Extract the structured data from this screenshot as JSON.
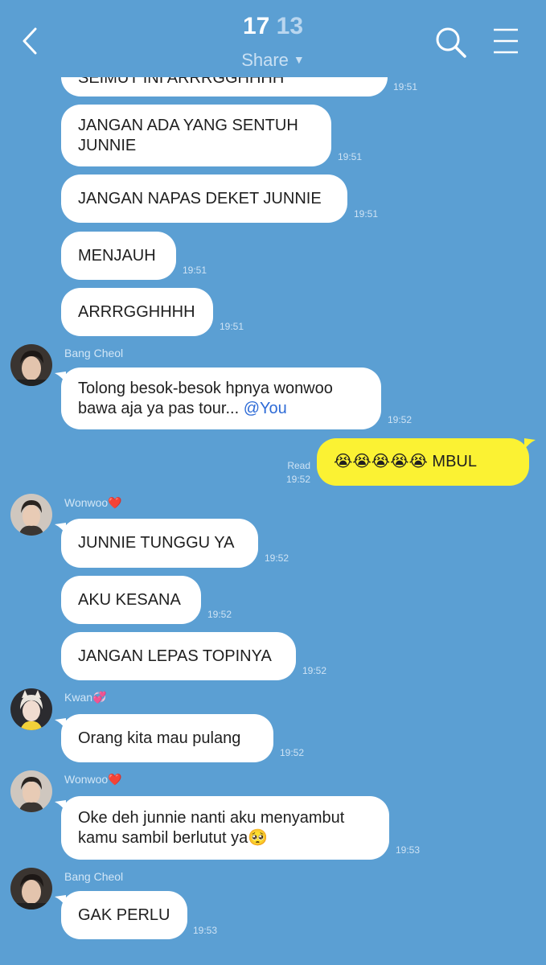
{
  "header": {
    "time_hour": "17",
    "time_min": "13",
    "share_label": "Share",
    "back_icon": "chevron-left-icon",
    "search_icon": "search-icon",
    "menu_icon": "hamburger-menu-icon"
  },
  "messages": [
    {
      "text": "SEIMUT INI ARRRGGHHHH",
      "time": "19:51"
    },
    {
      "text": "JANGAN ADA YANG SENTUH\nJUNNIE",
      "time": "19:51"
    },
    {
      "text": "JANGAN NAPAS DEKET JUNNIE",
      "time": "19:51"
    },
    {
      "text": "MENJAUH",
      "time": "19:51"
    },
    {
      "text": "ARRRGGHHHH",
      "time": "19:51"
    },
    {
      "sender": "Bang Cheol",
      "text": "Tolong besok-besok hpnya wonwoo\nbawa aja ya pas tour... ",
      "mention": "@You",
      "time": "19:52"
    },
    {
      "mine": true,
      "text": "😭😭😭😭😭 MBUL",
      "read": "Read",
      "time": "19:52"
    },
    {
      "sender": "Wonwoo❤️",
      "text": "JUNNIE TUNGGU YA",
      "time": "19:52"
    },
    {
      "text": "AKU KESANA",
      "time": "19:52"
    },
    {
      "text": "JANGAN LEPAS TOPINYA",
      "time": "19:52"
    },
    {
      "sender": "Kwan💞",
      "text": "Orang kita mau pulang",
      "time": "19:52"
    },
    {
      "sender": "Wonwoo❤️",
      "text": "Oke deh junnie nanti aku menyambut\nkamu sambil berlutut ya🥺",
      "time": "19:53"
    },
    {
      "sender": "Bang Cheol",
      "text": "GAK PERLU",
      "time": "19:53"
    }
  ],
  "colors": {
    "background": "#5b9fd3",
    "bubble_other": "#ffffff",
    "bubble_mine": "#fbf233",
    "mention": "#2e6bd6"
  }
}
